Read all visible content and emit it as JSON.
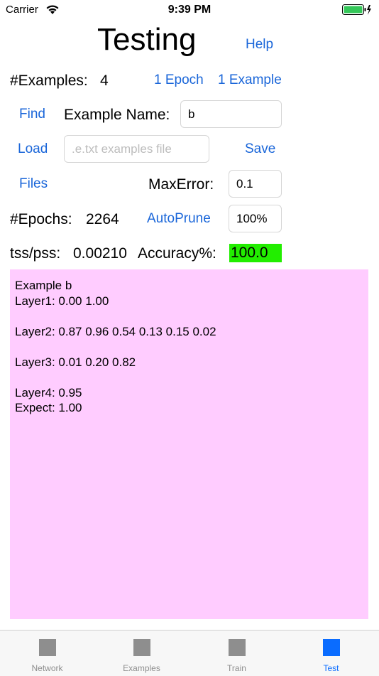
{
  "status_bar": {
    "carrier": "Carrier",
    "time": "9:39 PM"
  },
  "header": {
    "title": "Testing",
    "help_label": "Help"
  },
  "examples_row": {
    "label": "#Examples:",
    "count": "4",
    "epoch_label": "1 Epoch",
    "example_label": "1 Example"
  },
  "find_row": {
    "find_label": "Find",
    "name_label": "Example Name:",
    "name_value": "b"
  },
  "load_row": {
    "load_label": "Load",
    "file_placeholder": ".e.txt examples file",
    "save_label": "Save"
  },
  "files_row": {
    "files_label": "Files",
    "maxerror_label": "MaxError:",
    "maxerror_value": "0.1"
  },
  "epochs_row": {
    "label": "#Epochs:",
    "value": "2264",
    "autoprune_label": "AutoPrune",
    "autoprune_value": "100%"
  },
  "stats_row": {
    "tss_label": "tss/pss:",
    "tss_value": "0.00210",
    "accuracy_label": "Accuracy%:",
    "accuracy_value": "100.0",
    "accuracy_color": "#22ee00"
  },
  "output": {
    "text": "Example b\nLayer1: 0.00 1.00\n\nLayer2: 0.87 0.96 0.54 0.13 0.15 0.02\n\nLayer3: 0.01 0.20 0.82\n\nLayer4: 0.95\nExpect: 1.00",
    "background": "#ffccff"
  },
  "tabs": [
    {
      "label": "Network"
    },
    {
      "label": "Examples"
    },
    {
      "label": "Train"
    },
    {
      "label": "Test"
    }
  ],
  "colors": {
    "accent": "#1a66d9",
    "tab_active": "#0a6cff",
    "tab_inactive": "#8e8e8e"
  }
}
